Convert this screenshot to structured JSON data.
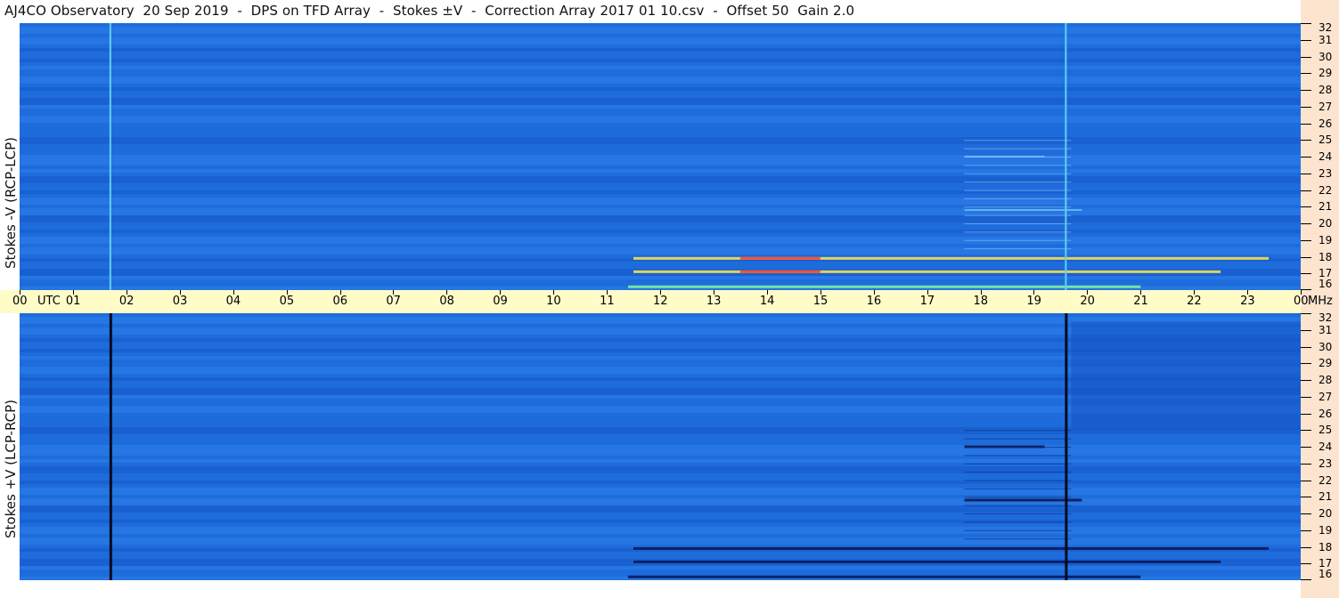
{
  "title": "AJ4CO Observatory  20 Sep 2019  -  DPS on TFD Array  -  Stokes ±V  -  Correction Array 2017 01 10.csv  -  Offset 50  Gain 2.0",
  "colors": {
    "background_blue": "#1e6cdc",
    "axis_band": "#fffcc8",
    "right_strip": "#fce4cf",
    "burst_hot": "#ff3a2a",
    "burst_warm": "#f5e050",
    "burst_green": "#7cf0a0"
  },
  "chart_data": [
    {
      "type": "heatmap",
      "panel": "top",
      "ylabel": "Stokes -V (RCP-LCP)",
      "x_tick_labels": [
        "00",
        "UTC",
        "01",
        "02",
        "03",
        "04",
        "05",
        "06",
        "07",
        "08",
        "09",
        "10",
        "11",
        "12",
        "13",
        "14",
        "15",
        "16",
        "17",
        "18",
        "19",
        "20",
        "21",
        "22",
        "23",
        "00",
        "MHz"
      ],
      "x_hours": [
        0,
        1,
        2,
        3,
        4,
        5,
        6,
        7,
        8,
        9,
        10,
        11,
        12,
        13,
        14,
        15,
        16,
        17,
        18,
        19,
        20,
        21,
        22,
        23,
        24
      ],
      "xlim_utc_hours": [
        0,
        24
      ],
      "y_tick_labels": [
        "32",
        "31",
        "30",
        "29",
        "28",
        "27",
        "26",
        "25",
        "24",
        "23",
        "22",
        "21",
        "20",
        "19",
        "18",
        "17",
        "16"
      ],
      "y_mhz": [
        32,
        31,
        30,
        29,
        28,
        27,
        26,
        25,
        24,
        23,
        22,
        21,
        20,
        19,
        18,
        17,
        16
      ],
      "ylim_mhz": [
        16,
        32
      ],
      "vertical_lines_utc": [
        1.7,
        19.6
      ],
      "emission_bands": [
        {
          "start_utc": 11.5,
          "end_utc": 23.4,
          "freq_mhz": 17.9,
          "intensity": "high"
        },
        {
          "start_utc": 11.5,
          "end_utc": 22.5,
          "freq_mhz": 17.1,
          "intensity": "high"
        },
        {
          "start_utc": 11.4,
          "end_utc": 21.0,
          "freq_mhz": 16.2,
          "intensity": "medium"
        },
        {
          "start_utc": 17.7,
          "end_utc": 19.9,
          "freq_mhz": 20.8,
          "intensity": "low"
        },
        {
          "start_utc": 17.7,
          "end_utc": 19.2,
          "freq_mhz": 24.0,
          "intensity": "low"
        }
      ]
    },
    {
      "type": "heatmap",
      "panel": "bottom",
      "ylabel": "Stokes +V (LCP-RCP)",
      "xlim_utc_hours": [
        0,
        24
      ],
      "y_tick_labels": [
        "32",
        "31",
        "30",
        "29",
        "28",
        "27",
        "26",
        "25",
        "24",
        "23",
        "22",
        "21",
        "20",
        "19",
        "18",
        "17",
        "16"
      ],
      "y_mhz": [
        32,
        31,
        30,
        29,
        28,
        27,
        26,
        25,
        24,
        23,
        22,
        21,
        20,
        19,
        18,
        17,
        16
      ],
      "ylim_mhz": [
        16,
        32
      ],
      "vertical_lines_utc": [
        1.7,
        19.6
      ],
      "emission_bands": [
        {
          "start_utc": 11.5,
          "end_utc": 23.4,
          "freq_mhz": 17.9,
          "intensity": "dark"
        },
        {
          "start_utc": 11.5,
          "end_utc": 22.5,
          "freq_mhz": 17.1,
          "intensity": "dark"
        },
        {
          "start_utc": 11.4,
          "end_utc": 21.0,
          "freq_mhz": 16.2,
          "intensity": "dark"
        },
        {
          "start_utc": 17.7,
          "end_utc": 19.9,
          "freq_mhz": 20.8,
          "intensity": "dark"
        },
        {
          "start_utc": 17.7,
          "end_utc": 19.2,
          "freq_mhz": 24.0,
          "intensity": "dark"
        }
      ]
    }
  ]
}
